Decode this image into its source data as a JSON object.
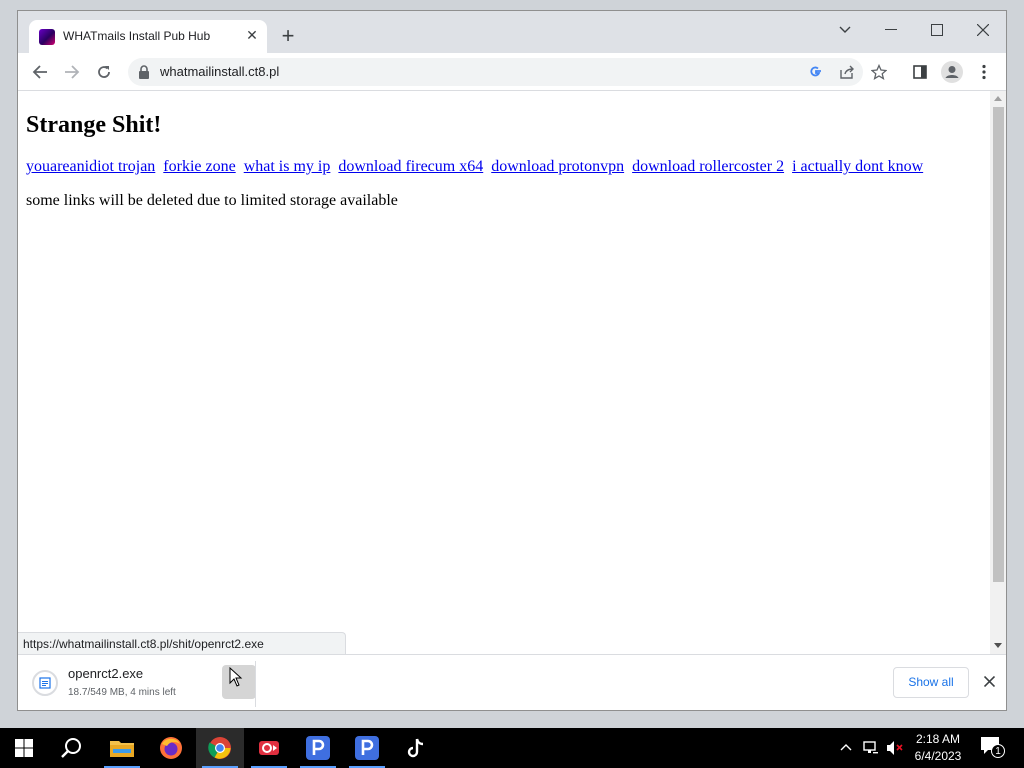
{
  "browser": {
    "tab_title": "WHATmails Install Pub Hub",
    "url": "whatmailinstall.ct8.pl",
    "status_url": "https://whatmailinstall.ct8.pl/shit/openrct2.exe"
  },
  "page": {
    "heading": "Strange Shit!",
    "links": [
      {
        "label": "youareanidiot trojan"
      },
      {
        "label": "forkie zone"
      },
      {
        "label": "what is my ip"
      },
      {
        "label": "download firecum x64"
      },
      {
        "label": "download protonvpn"
      },
      {
        "label": "download rollercoster 2"
      },
      {
        "label": "i actually dont know"
      }
    ],
    "notice": "some links will be deleted due to limited storage available"
  },
  "download": {
    "filename": "openrct2.exe",
    "progress_text": "18.7/549 MB, 4 mins left",
    "show_all_label": "Show all"
  },
  "taskbar": {
    "apps": [
      "windows-start-icon",
      "search-icon",
      "file-explorer-icon",
      "firefox-icon",
      "chrome-icon",
      "video-recorder-icon",
      "pub-p-icon",
      "pub-p-icon-2",
      "tiktok-icon"
    ],
    "time": "2:18 AM",
    "date": "6/4/2023",
    "notification_count": "1"
  },
  "colors": {
    "link": "#0000ee",
    "accent": "#1a73e8",
    "taskbar": "#000000"
  }
}
